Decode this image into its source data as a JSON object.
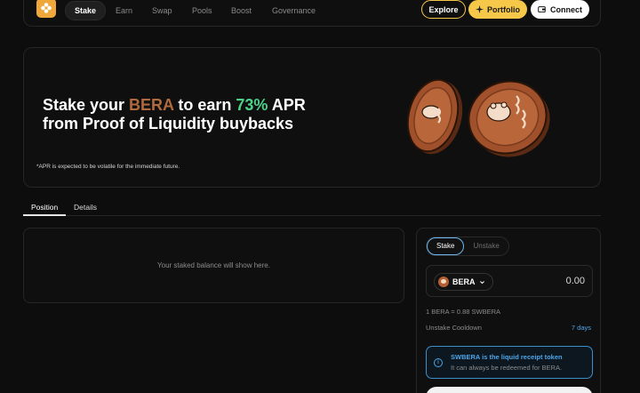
{
  "nav": {
    "items": [
      {
        "label": "Stake",
        "active": true
      },
      {
        "label": "Earn"
      },
      {
        "label": "Swap"
      },
      {
        "label": "Pools"
      },
      {
        "label": "Boost"
      },
      {
        "label": "Governance"
      }
    ],
    "explore_label": "Explore",
    "portfolio_label": "Portfolio",
    "connect_label": "Connect"
  },
  "hero": {
    "title_prefix": "Stake your ",
    "title_token": "BERA",
    "title_middle": " to earn ",
    "title_apr": "73%",
    "title_suffix": " APR",
    "title_line2": "from Proof of Liquidity buybacks",
    "note": "*APR is expected to be volatile for the immediate future."
  },
  "tabs": [
    "Position",
    "Details"
  ],
  "position": {
    "empty_text": "Your staked balance will show here."
  },
  "stake_panel": {
    "toggle": [
      "Stake",
      "Unstake"
    ],
    "token": "BERA",
    "amount": "0.00",
    "rate": "1 BERA = 0.88 SWBERA",
    "cooldown_label": "Unstake Cooldown",
    "cooldown_value": "7 days",
    "info_title": "SWBERA is the liquid receipt token",
    "info_sub": "It can always be redeemed for BERA."
  },
  "colors": {
    "accent_yellow": "#f5c84a",
    "bera_brown": "#b06a3e",
    "apr_green": "#4cd38a",
    "info_blue": "#4ea6e8"
  }
}
